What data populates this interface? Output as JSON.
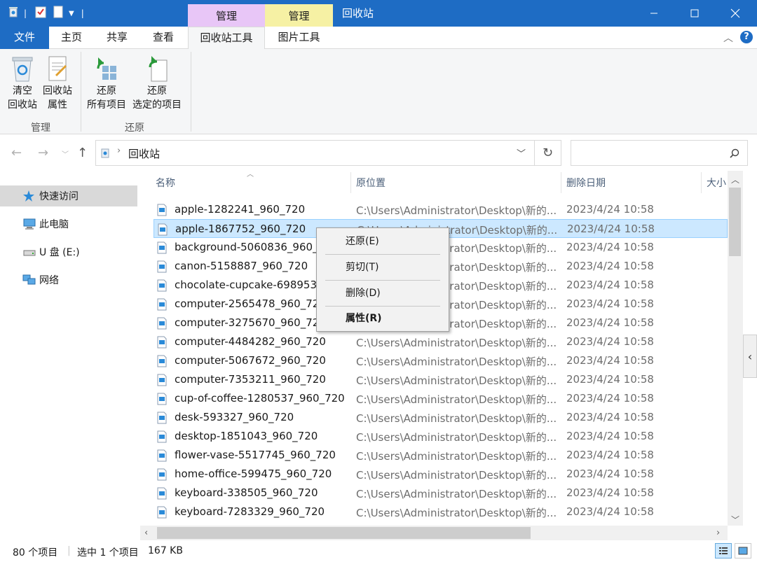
{
  "window": {
    "title": "回收站",
    "context_tab_manage_1": "管理",
    "context_tab_manage_2": "管理"
  },
  "tabs": {
    "file": "文件",
    "home": "主页",
    "share": "共享",
    "view": "查看",
    "recycle_tools": "回收站工具",
    "picture_tools": "图片工具"
  },
  "ribbon": {
    "empty_line1": "清空",
    "empty_line2": "回收站",
    "props_line1": "回收站",
    "props_line2": "属性",
    "restore_all_line1": "还原",
    "restore_all_line2": "所有项目",
    "restore_sel_line1": "还原",
    "restore_sel_line2": "选定的项目",
    "group_manage": "管理",
    "group_restore": "还原"
  },
  "address": {
    "location": "回收站",
    "search_placeholder": ""
  },
  "nav": {
    "quick_access": "快速访问",
    "this_pc": "此电脑",
    "u_disk": "U 盘 (E:)",
    "network": "网络"
  },
  "columns": {
    "name": "名称",
    "orig_location": "原位置",
    "date_deleted": "删除日期",
    "size": "大小"
  },
  "files": [
    {
      "name": "apple-1282241_960_720",
      "path": "C:\\Users\\Administrator\\Desktop\\新的...",
      "date": "2023/4/24 10:58"
    },
    {
      "name": "apple-1867752_960_720",
      "path": "C:\\Users\\Administrator\\Desktop\\新的...",
      "date": "2023/4/24 10:58"
    },
    {
      "name": "background-5060836_960_720",
      "path": "C:\\Users\\Administrator\\Desktop\\新的...",
      "date": "2023/4/24 10:58"
    },
    {
      "name": "canon-5158887_960_720",
      "path": "C:\\Users\\Administrator\\Desktop\\新的...",
      "date": "2023/4/24 10:58"
    },
    {
      "name": "chocolate-cupcake-6989538_960_720",
      "path": "C:\\Users\\Administrator\\Desktop\\新的...",
      "date": "2023/4/24 10:58"
    },
    {
      "name": "computer-2565478_960_720",
      "path": "C:\\Users\\Administrator\\Desktop\\新的...",
      "date": "2023/4/24 10:58"
    },
    {
      "name": "computer-3275670_960_720",
      "path": "C:\\Users\\Administrator\\Desktop\\新的...",
      "date": "2023/4/24 10:58"
    },
    {
      "name": "computer-4484282_960_720",
      "path": "C:\\Users\\Administrator\\Desktop\\新的...",
      "date": "2023/4/24 10:58"
    },
    {
      "name": "computer-5067672_960_720",
      "path": "C:\\Users\\Administrator\\Desktop\\新的...",
      "date": "2023/4/24 10:58"
    },
    {
      "name": "computer-7353211_960_720",
      "path": "C:\\Users\\Administrator\\Desktop\\新的...",
      "date": "2023/4/24 10:58"
    },
    {
      "name": "cup-of-coffee-1280537_960_720",
      "path": "C:\\Users\\Administrator\\Desktop\\新的...",
      "date": "2023/4/24 10:58"
    },
    {
      "name": "desk-593327_960_720",
      "path": "C:\\Users\\Administrator\\Desktop\\新的...",
      "date": "2023/4/24 10:58"
    },
    {
      "name": "desktop-1851043_960_720",
      "path": "C:\\Users\\Administrator\\Desktop\\新的...",
      "date": "2023/4/24 10:58"
    },
    {
      "name": "flower-vase-5517745_960_720",
      "path": "C:\\Users\\Administrator\\Desktop\\新的...",
      "date": "2023/4/24 10:58"
    },
    {
      "name": "home-office-599475_960_720",
      "path": "C:\\Users\\Administrator\\Desktop\\新的...",
      "date": "2023/4/24 10:58"
    },
    {
      "name": "keyboard-338505_960_720",
      "path": "C:\\Users\\Administrator\\Desktop\\新的...",
      "date": "2023/4/24 10:58"
    },
    {
      "name": "keyboard-7283329_960_720",
      "path": "C:\\Users\\Administrator\\Desktop\\新的...",
      "date": "2023/4/24 10:58"
    }
  ],
  "context_menu": {
    "restore": "还原(E)",
    "cut": "剪切(T)",
    "delete": "删除(D)",
    "properties": "属性(R)"
  },
  "status": {
    "item_count": "80 个项目",
    "selected": "选中 1 个项目",
    "size": "167 KB"
  },
  "colors": {
    "titlebar": "#1e6cc4",
    "manage_tab_1": "#e8c6f7",
    "manage_tab_2": "#f6f1a4",
    "selection": "#cce8ff"
  }
}
